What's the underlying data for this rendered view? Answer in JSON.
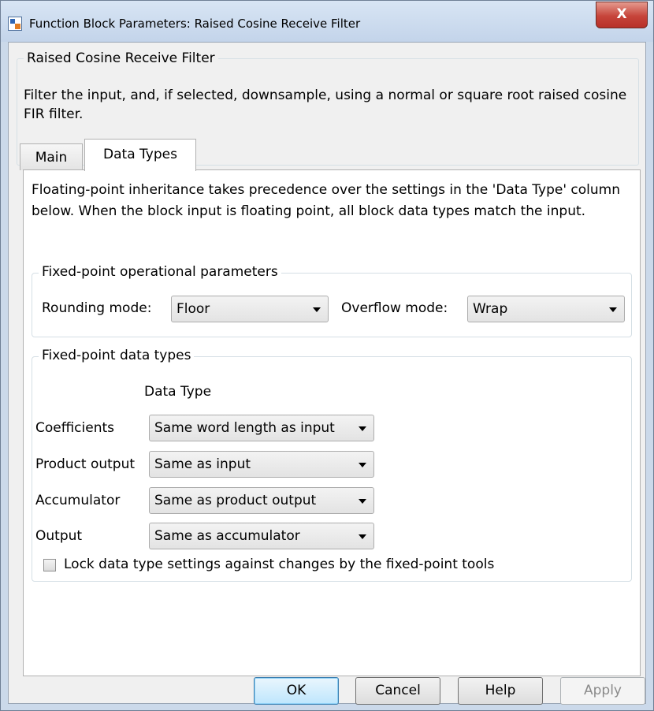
{
  "window": {
    "title": "Function Block Parameters: Raised Cosine Receive Filter",
    "close_label": "X"
  },
  "description": {
    "group_title": "Raised Cosine Receive Filter",
    "text": "Filter the input, and, if selected, downsample, using a normal or square root raised cosine FIR filter."
  },
  "tabs": [
    {
      "label": "Main",
      "active": false
    },
    {
      "label": "Data Types",
      "active": true
    }
  ],
  "panel": {
    "info_text": "Floating-point inheritance takes precedence over the settings in the 'Data Type' column below. When the block input is floating point, all block data types match the input.",
    "operational": {
      "title": "Fixed-point operational parameters",
      "rounding_label": "Rounding mode:",
      "rounding_value": "Floor",
      "overflow_label": "Overflow mode:",
      "overflow_value": "Wrap"
    },
    "datatypes": {
      "title": "Fixed-point data types",
      "column_header": "Data Type",
      "rows": [
        {
          "label": "Coefficients",
          "value": "Same word length as input"
        },
        {
          "label": "Product output",
          "value": "Same as input"
        },
        {
          "label": "Accumulator",
          "value": "Same as product output"
        },
        {
          "label": "Output",
          "value": "Same as accumulator"
        }
      ],
      "lock_label": "Lock data type settings against changes by the fixed-point tools",
      "lock_checked": false
    }
  },
  "buttons": {
    "ok": "OK",
    "cancel": "Cancel",
    "help": "Help",
    "apply": "Apply"
  }
}
